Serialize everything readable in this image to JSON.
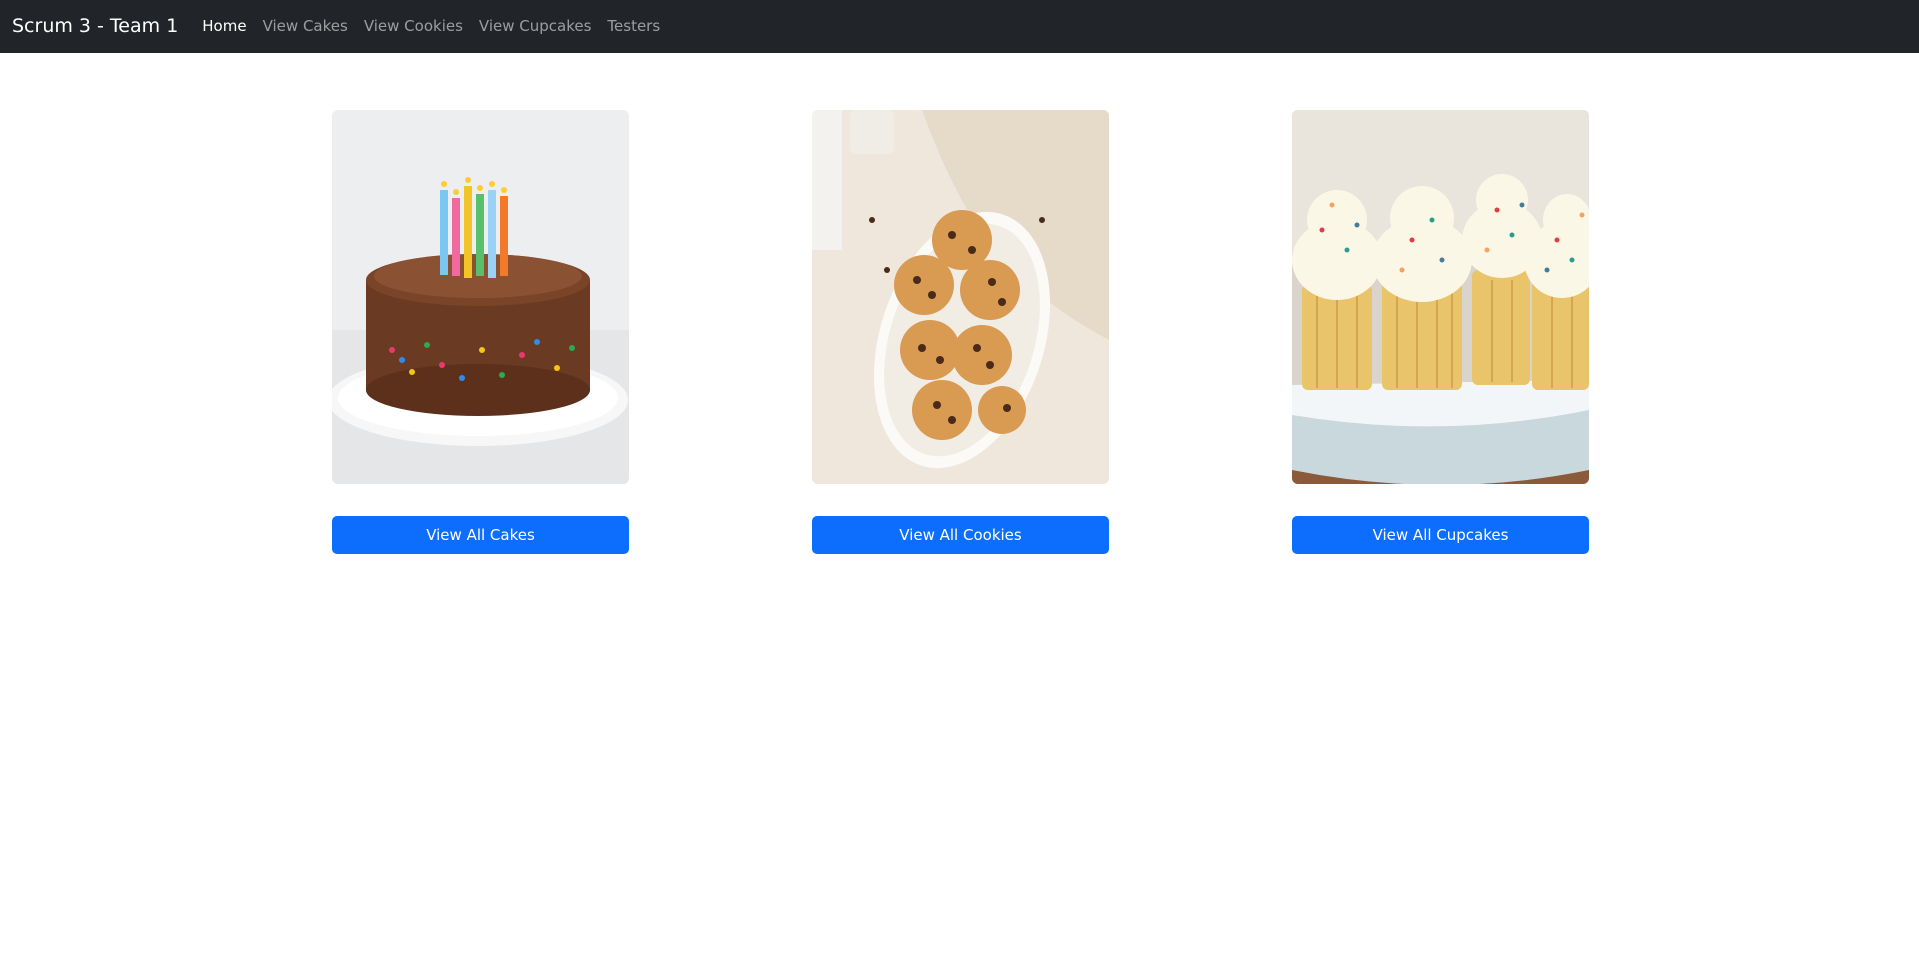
{
  "navbar": {
    "brand": "Scrum 3 - Team 1",
    "links": [
      {
        "label": "Home",
        "active": true
      },
      {
        "label": "View Cakes",
        "active": false
      },
      {
        "label": "View Cookies",
        "active": false
      },
      {
        "label": "View Cupcakes",
        "active": false
      },
      {
        "label": "Testers",
        "active": false
      }
    ]
  },
  "cards": [
    {
      "image": "birthday-cake-photo",
      "button_label": "View All Cakes"
    },
    {
      "image": "chocolate-chip-cookies-photo",
      "button_label": "View All Cookies"
    },
    {
      "image": "vanilla-cupcakes-photo",
      "button_label": "View All Cupcakes"
    }
  ],
  "colors": {
    "navbar_bg": "#212529",
    "primary": "#0d6efd",
    "page_bg": "#ffffff"
  }
}
